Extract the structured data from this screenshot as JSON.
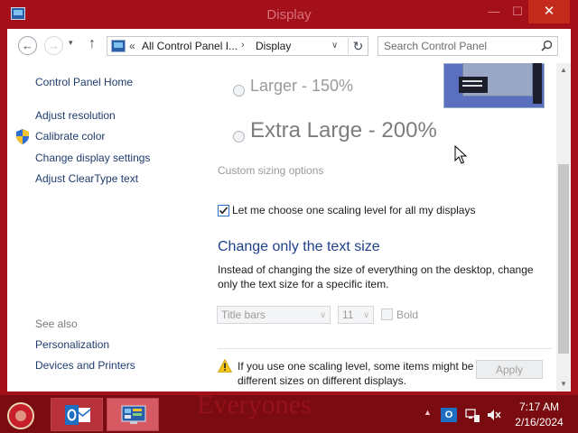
{
  "window": {
    "title": "Display",
    "minimize_glyph": "—",
    "maximize_glyph": "☐",
    "close_glyph": "✕"
  },
  "navbar": {
    "back_glyph": "←",
    "forward_glyph": "→",
    "recent_glyph": "▾",
    "up_glyph": "↑",
    "address_chevron": "«",
    "crumbs": [
      "All Control Panel I...",
      "Display"
    ],
    "crumb_separator": "›",
    "address_dropdown_glyph": "∨",
    "refresh_glyph": "↻",
    "search_placeholder": "Search Control Panel"
  },
  "left_pane": {
    "home": "Control Panel Home",
    "links": [
      "Adjust resolution",
      "Calibrate color",
      "Change display settings",
      "Adjust ClearType text"
    ],
    "see_also_heading": "See also",
    "see_also": [
      "Personalization",
      "Devices and Printers"
    ]
  },
  "main": {
    "options": [
      {
        "label": "Larger - 150%",
        "selected": false
      },
      {
        "label": "Extra Large - 200%",
        "selected": false
      }
    ],
    "custom_sizing": "Custom sizing options",
    "one_scaling_checkbox": {
      "label": "Let me choose one scaling level for all my displays",
      "checked": true
    },
    "text_size_title": "Change only the text size",
    "text_size_desc": "Instead of changing the size of everything on the desktop, change only the text size for a specific item.",
    "item_select": {
      "value": "Title bars"
    },
    "size_select": {
      "value": "11"
    },
    "bold_label": "Bold",
    "warning_text": "If you use one scaling level, some items might be different sizes on different displays.",
    "apply_label": "Apply",
    "select_arrow_glyph": "∨"
  },
  "scrollbar": {
    "up_glyph": "▲",
    "down_glyph": "▼"
  },
  "taskbar": {
    "wallpaper_text": "Everyones",
    "tray_expand_glyph": "▲",
    "tray_outlook_label": "O",
    "clock_time": "7:17 AM",
    "clock_date": "2/16/2024"
  },
  "colors": {
    "frame": "#a3101a",
    "taskbar": "#7a0b10",
    "link": "#1f3c6e",
    "section_title": "#1e3f8a",
    "close_button": "#c42b1c"
  }
}
